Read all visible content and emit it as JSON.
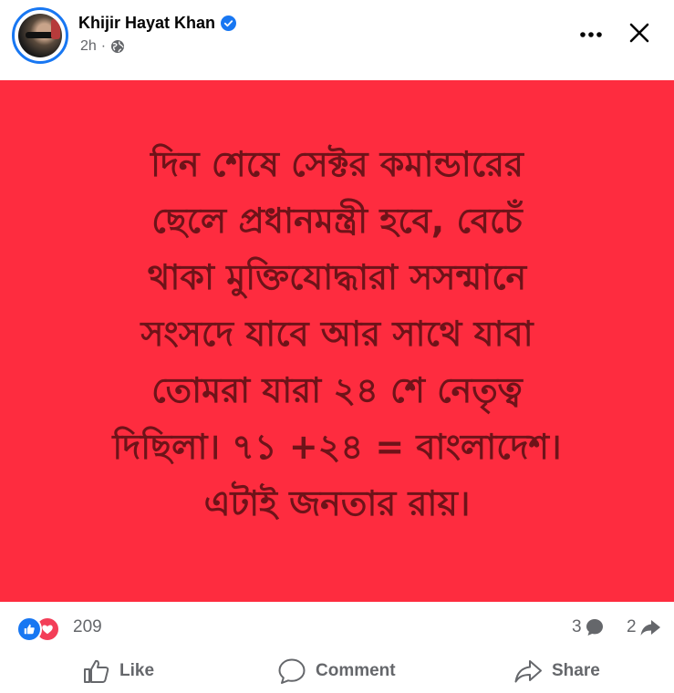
{
  "post": {
    "author": "Khijir Hayat Khan",
    "time": "2h",
    "separator": "·",
    "image_text": "দিন শেষে সেক্টর কমান্ডারের\nছেলে প্রধানমন্ত্রী হবে, বেচেঁ\nথাকা মুক্তিযোদ্ধারা সসন্মানে\nসংসদে যাবে আর সাথে যাবা\nতোমরা যারা ২৪ শে নেতৃত্ব\nদিছিলা। ৭১ +২৪ = বাংলাদেশ।\nএটাই জনতার রায়।"
  },
  "colors": {
    "background": "#fe2c3f",
    "text": "#6e1319",
    "accent": "#1877f2"
  },
  "stats": {
    "reactions": "209",
    "comments": "3",
    "shares": "2"
  },
  "actions": {
    "like": "Like",
    "comment": "Comment",
    "share": "Share"
  },
  "icons": [
    "verified-badge-icon",
    "globe-icon",
    "more-options-icon",
    "close-icon",
    "like-reaction-icon",
    "love-reaction-icon",
    "comment-bubble-icon",
    "share-arrow-icon",
    "thumbs-up-icon",
    "comment-icon",
    "share-icon"
  ]
}
